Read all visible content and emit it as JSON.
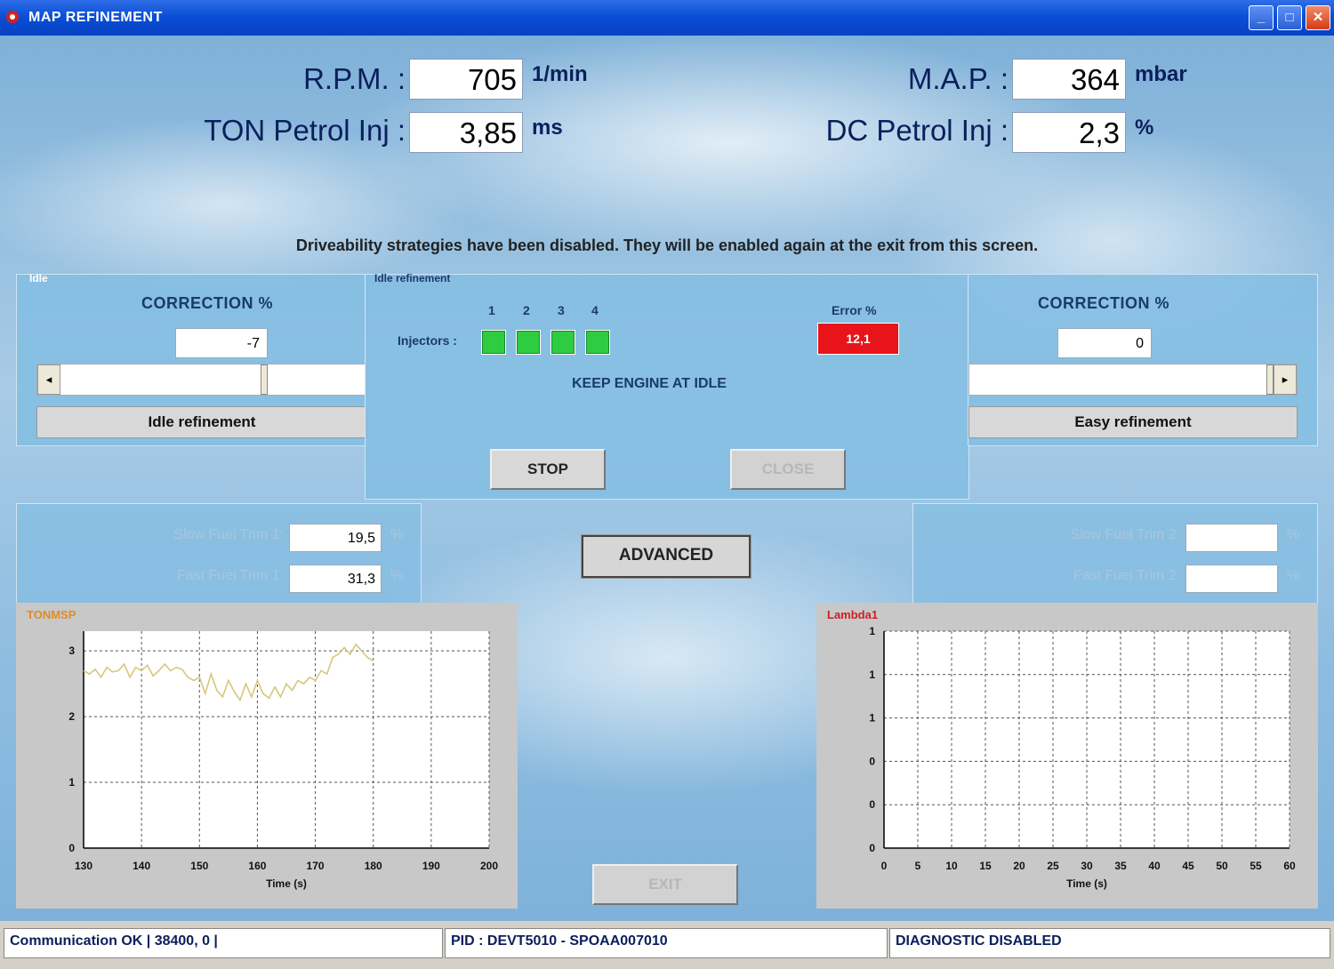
{
  "window": {
    "title": "MAP REFINEMENT"
  },
  "readouts": {
    "rpm": {
      "label": "R.P.M. :",
      "value": "705",
      "unit": "1/min"
    },
    "ton": {
      "label": "TON Petrol Inj :",
      "value": "3,85",
      "unit": "ms"
    },
    "map": {
      "label": "M.A.P. :",
      "value": "364",
      "unit": "mbar"
    },
    "dc": {
      "label": "DC Petrol Inj :",
      "value": "2,3",
      "unit": "%"
    }
  },
  "notice": "Driveability strategies have been disabled. They will be enabled again at the exit from this screen.",
  "idle_panel": {
    "legend": "Idle",
    "correction_label": "CORRECTION %",
    "correction_value": "-7",
    "slider_fraction": 0.78,
    "button": "Idle refinement"
  },
  "center_panel": {
    "legend": "Idle refinement",
    "injector_label": "Injectors :",
    "injector_numbers": [
      "1",
      "2",
      "3",
      "4"
    ],
    "error_label": "Error %",
    "error_value": "12,1",
    "message": "KEEP ENGINE AT IDLE",
    "stop": "STOP",
    "close": "CLOSE"
  },
  "easy_panel": {
    "correction_label": "CORRECTION %",
    "correction_value": "0",
    "button": "Easy refinement"
  },
  "fuel_trim_left": {
    "slow_label": "Slow Fuel Trim 1:",
    "slow_value": "19,5",
    "fast_label": "Fast Fuel Trim 1:",
    "fast_value": "31,3",
    "unit": "%"
  },
  "fuel_trim_right": {
    "slow_label": "Slow Fuel Trim 2:",
    "slow_value": "",
    "fast_label": "Fast Fuel Trim 2:",
    "fast_value": "",
    "unit": "%"
  },
  "advanced_button": "ADVANCED",
  "exit_button": "EXIT",
  "status": {
    "comm": "Communication OK | 38400,  0 |",
    "pid": "PID : DEVT5010 - SPOAA007010",
    "diag": "DIAGNOSTIC DISABLED"
  },
  "colors": {
    "title_bar": "#0a4fd6",
    "injector_ok": "#2ecc40",
    "error": "#e8141a",
    "tonmsp_line": "#d8c77a",
    "tonmsp_title": "#e08a2a",
    "lambda_title": "#d02020"
  },
  "chart_data": [
    {
      "type": "line",
      "title": "TONMSP",
      "xlabel": "Time (s)",
      "xlim": [
        130,
        200
      ],
      "ylim": [
        0,
        3.3
      ],
      "x_ticks": [
        "130",
        "140",
        "150",
        "160",
        "170",
        "180",
        "190",
        "200"
      ],
      "y_ticks": [
        "0",
        "1",
        "2",
        "3"
      ],
      "grid": true,
      "series": [
        {
          "x": [
            130,
            131,
            132,
            133,
            134,
            135,
            136,
            137,
            138,
            139,
            140,
            141,
            142,
            143,
            144,
            145,
            146,
            147,
            148,
            149,
            150,
            151,
            152,
            153,
            154,
            155,
            156,
            157,
            158,
            159,
            160,
            161,
            162,
            163,
            164,
            165,
            166,
            167,
            168,
            169,
            170,
            171,
            172,
            173,
            174,
            175,
            176,
            177,
            178,
            179,
            180
          ],
          "y": [
            2.7,
            2.65,
            2.72,
            2.6,
            2.75,
            2.68,
            2.7,
            2.8,
            2.6,
            2.75,
            2.7,
            2.78,
            2.62,
            2.7,
            2.8,
            2.7,
            2.75,
            2.72,
            2.6,
            2.55,
            2.6,
            2.35,
            2.65,
            2.4,
            2.3,
            2.55,
            2.38,
            2.25,
            2.5,
            2.3,
            2.55,
            2.35,
            2.28,
            2.45,
            2.3,
            2.5,
            2.4,
            2.55,
            2.5,
            2.6,
            2.55,
            2.7,
            2.65,
            2.9,
            2.95,
            3.05,
            2.95,
            3.1,
            3.0,
            2.9,
            2.85
          ]
        }
      ]
    },
    {
      "type": "line",
      "title": "Lambda1",
      "xlabel": "Time (s)",
      "xlim": [
        0,
        60
      ],
      "x_ticks": [
        "0",
        "5",
        "10",
        "15",
        "20",
        "25",
        "30",
        "35",
        "40",
        "45",
        "50",
        "55",
        "60"
      ],
      "y_ticks": [
        "0",
        "0",
        "0",
        "1",
        "1",
        "1"
      ],
      "grid": true,
      "series": []
    }
  ]
}
